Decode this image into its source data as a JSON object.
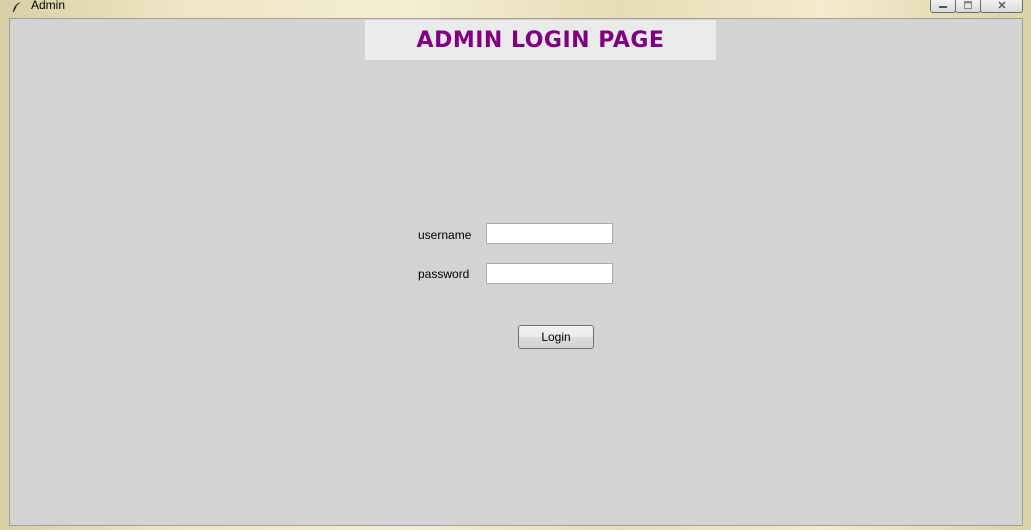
{
  "window": {
    "title": "Admin",
    "icon": "feather-icon",
    "controls": [
      "minimize-icon",
      "maximize-icon",
      "close-icon"
    ]
  },
  "header": {
    "title": "ADMIN LOGIN PAGE",
    "title_color": "#800080"
  },
  "form": {
    "username_label": "username",
    "username_value": "",
    "password_label": "password",
    "password_value": "",
    "login_label": "Login"
  },
  "colors": {
    "client_bg": "#d3d3d3",
    "banner_bg": "#eaeaea"
  }
}
